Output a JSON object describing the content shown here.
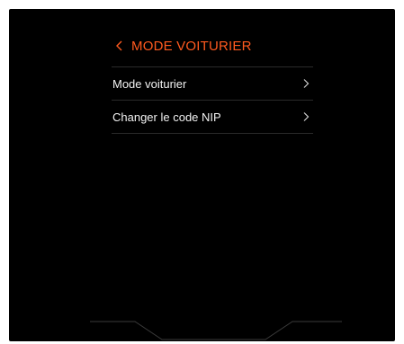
{
  "screen": {
    "title": "MODE VOITURIER",
    "back_icon": "chevron-left-icon",
    "accent_color": "#ff5a1f",
    "background_color": "#000000",
    "text_color": "#f2f2f2"
  },
  "menu": {
    "items": [
      {
        "label": "Mode voiturier",
        "icon": "chevron-right-icon"
      },
      {
        "label": "Changer le code NIP",
        "icon": "chevron-right-icon"
      }
    ]
  }
}
